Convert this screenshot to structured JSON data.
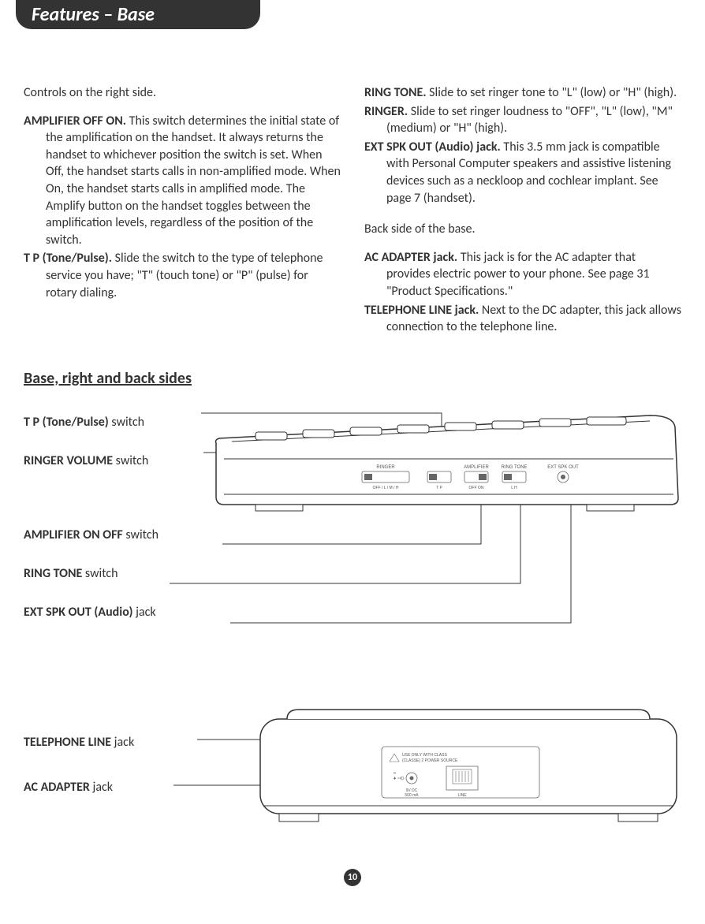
{
  "header": "Features – Base",
  "left": {
    "intro": "Controls on the right side.",
    "amplifier": {
      "title": "AMPLIFIER OFF ON.",
      "body": " This switch determines the initial state of the amplification on the handset. It always returns the handset to whichever position the switch is set. When Off, the handset starts calls in non-amplified mode. When On, the handset starts calls in amplified mode. The Amplify button on the handset toggles between the amplification levels, regardless of the position of the switch."
    },
    "tp": {
      "title": "T P (Tone/Pulse).",
      "body": " Slide the switch to the type of telephone service you have; \"T\" (touch tone) or \"P\" (pulse) for rotary dialing."
    }
  },
  "right": {
    "ringtone": {
      "title": "RING TONE.",
      "body": " Slide to set ringer tone to \"L\" (low) or \"H\" (high)."
    },
    "ringer": {
      "title": "RINGER.",
      "body": " Slide to set ringer loudness to \"OFF\", \"L\" (low), \"M\" (medium) or \"H\" (high)."
    },
    "extspk": {
      "title": "EXT SPK OUT (Audio) jack.",
      "body": " This 3.5 mm jack is compatible with Personal Computer speakers and assistive listening devices such as a neckloop and cochlear implant. See page 7 (handset)."
    },
    "backintro": "Back side of the base.",
    "ac": {
      "title": "AC ADAPTER jack.",
      "body": " This jack is for the AC adapter that provides electric power to your phone. See page 31 \"Product Specifications.\""
    },
    "tel": {
      "title": "TELEPHONE LINE jack.",
      "body": " Next to the DC adapter, this jack allows connection to the telephone line."
    }
  },
  "subhead": "Base, right and back sides",
  "callouts": {
    "tp": {
      "bold": "T P (Tone/Pulse)",
      "rest": " switch"
    },
    "ringer_vol": {
      "bold": "RINGER VOLUME",
      "rest": " switch"
    },
    "amp": {
      "bold": "AMPLIFIER ON OFF",
      "rest": " switch"
    },
    "ringtone": {
      "bold": "RING TONE",
      "rest": " switch"
    },
    "extspk": {
      "bold": "EXT SPK OUT (Audio)",
      "rest": " jack"
    },
    "telline": {
      "bold": "TELEPHONE LINE",
      "rest": " jack"
    },
    "acadapter": {
      "bold": "AC ADAPTER",
      "rest": " jack"
    }
  },
  "device_labels": {
    "ringer": "RINGER",
    "ringer_sub": "OFF / L / M / H",
    "tp": "T    P",
    "amplifier": "AMPLIFIER",
    "amp_sub": "OFF    ON",
    "ringtone": "RING TONE",
    "ringtone_sub": "L    H",
    "extspk": "EXT SPK OUT",
    "back_warn1": "USE ONLY WITH CLASS",
    "back_warn2": "(CLASSE) 2 POWER SOURCE",
    "back_dc1": "9V DC",
    "back_dc2": "500 mA",
    "back_line": "LINE"
  },
  "page_number": "10"
}
